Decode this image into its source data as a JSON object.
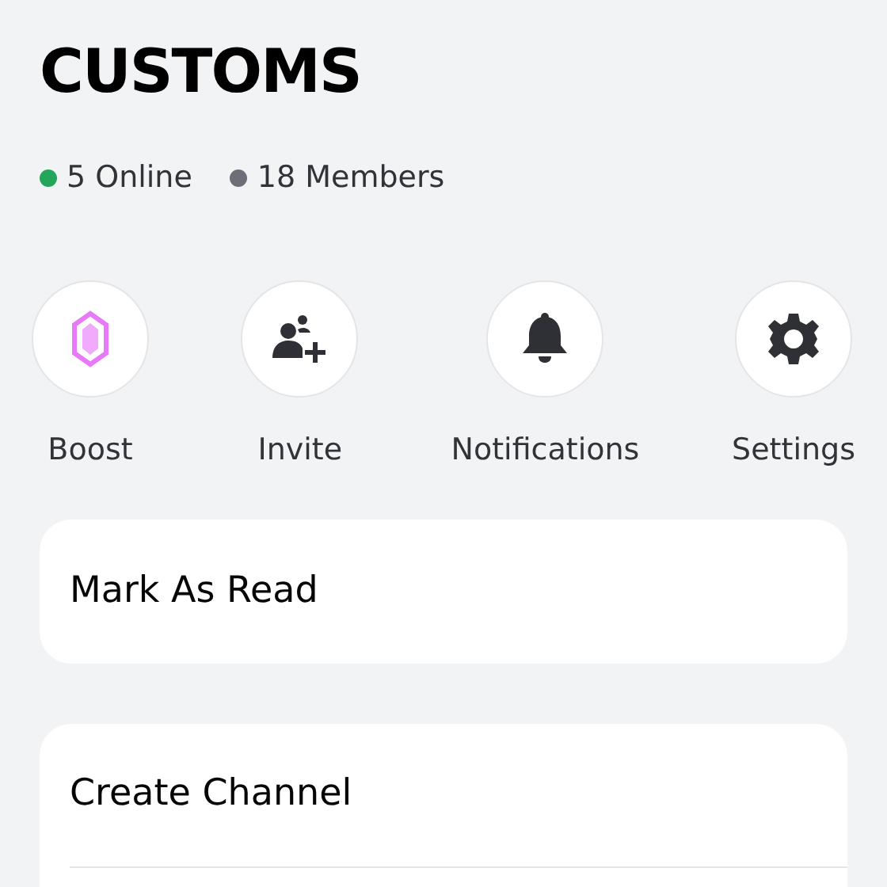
{
  "server": {
    "name": "CUSTOMS"
  },
  "stats": [
    {
      "label": "5 Online",
      "color": "#23a55a"
    },
    {
      "label": "18 Members",
      "color": "#6d6f78"
    }
  ],
  "actions": [
    {
      "kind": "boost",
      "label": "Boost"
    },
    {
      "kind": "invite",
      "label": "Invite"
    },
    {
      "kind": "notifications",
      "label": "Notifications"
    },
    {
      "kind": "settings",
      "label": "Settings"
    }
  ],
  "menu_groups": [
    {
      "items": [
        "Mark As Read"
      ]
    },
    {
      "items": [
        "Create Channel"
      ]
    }
  ]
}
